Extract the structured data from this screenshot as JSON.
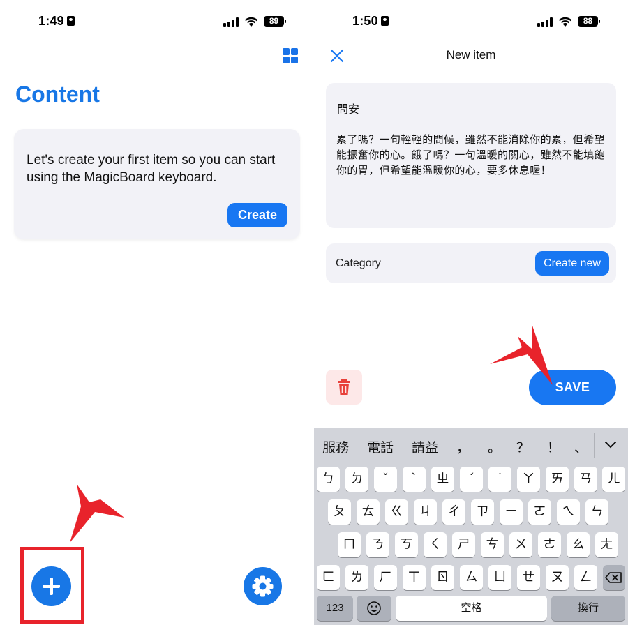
{
  "left": {
    "status": {
      "time": "1:49",
      "battery": "89"
    },
    "title": "Content",
    "intro": {
      "text": "Let's create your first item so you can start using the MagicBoard keyboard.",
      "button": "Create"
    }
  },
  "right": {
    "status": {
      "time": "1:50",
      "battery": "88"
    },
    "nav_title": "New item",
    "item": {
      "name": "問安",
      "body": "累了嗎？一句輕輕的問候，雖然不能消除你的累，但希望能振奮你的心。餓了嗎？一句溫暖的關心，雖然不能填飽你的胃，但希望能溫暖你的心，要多休息喔！"
    },
    "category": {
      "label": "Category",
      "button": "Create new"
    },
    "save_label": "SAVE",
    "keyboard": {
      "candidates": [
        "服務",
        "電話",
        "請益",
        "，",
        "。",
        "？",
        "！",
        "、"
      ],
      "row1": [
        "ㄅ",
        "ㄉ",
        "ˇ",
        "ˋ",
        "ㄓ",
        "ˊ",
        "˙",
        "ㄚ",
        "ㄞ",
        "ㄢ",
        "ㄦ"
      ],
      "row2": [
        "ㄆ",
        "ㄊ",
        "ㄍ",
        "ㄐ",
        "ㄔ",
        "ㄗ",
        "ㄧ",
        "ㄛ",
        "ㄟ",
        "ㄣ"
      ],
      "row3": [
        "ㄇ",
        "ㄋ",
        "ㄎ",
        "ㄑ",
        "ㄕ",
        "ㄘ",
        "ㄨ",
        "ㄜ",
        "ㄠ",
        "ㄤ"
      ],
      "row4": [
        "ㄈ",
        "ㄌ",
        "ㄏ",
        "ㄒ",
        "ㄖ",
        "ㄙ",
        "ㄩ",
        "ㄝ",
        "ㄡ",
        "ㄥ"
      ],
      "numbers_key": "123",
      "space_key": "空格",
      "return_key": "換行"
    }
  },
  "colors": {
    "accent": "#1877f2",
    "highlight_red": "#e8232b",
    "card_bg": "#f2f2f7",
    "keyboard_bg": "#d2d4da"
  },
  "icons": [
    "grid-icon",
    "plus-icon",
    "gear-icon",
    "close-icon",
    "trash-icon",
    "chevron-down-icon",
    "emoji-icon",
    "backspace-icon",
    "pointer-arrow-icon"
  ]
}
